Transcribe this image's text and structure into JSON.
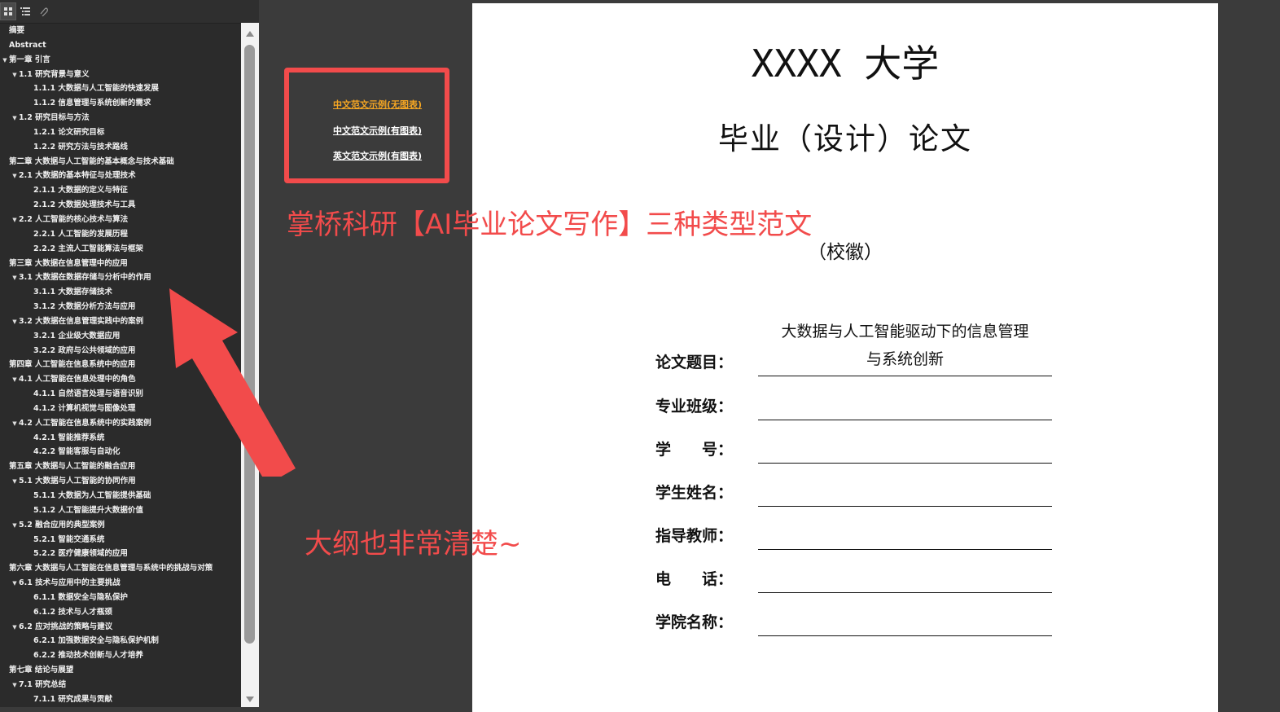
{
  "outline": [
    {
      "level": 0,
      "toggle": false,
      "label": "摘要"
    },
    {
      "level": 0,
      "toggle": false,
      "label": "Abstract"
    },
    {
      "level": 0,
      "toggle": true,
      "label": "第一章 引言"
    },
    {
      "level": 1,
      "toggle": true,
      "label": "1.1 研究背景与意义"
    },
    {
      "level": 2,
      "toggle": false,
      "label": "1.1.1 大数据与人工智能的快速发展"
    },
    {
      "level": 2,
      "toggle": false,
      "label": "1.1.2 信息管理与系统创新的需求"
    },
    {
      "level": 1,
      "toggle": true,
      "label": "1.2 研究目标与方法"
    },
    {
      "level": 2,
      "toggle": false,
      "label": "1.2.1 论文研究目标"
    },
    {
      "level": 2,
      "toggle": false,
      "label": "1.2.2 研究方法与技术路线"
    },
    {
      "level": 0,
      "toggle": false,
      "label": "第二章 大数据与人工智能的基本概念与技术基础"
    },
    {
      "level": 1,
      "toggle": true,
      "label": "2.1 大数据的基本特征与处理技术"
    },
    {
      "level": 2,
      "toggle": false,
      "label": "2.1.1 大数据的定义与特征"
    },
    {
      "level": 2,
      "toggle": false,
      "label": "2.1.2 大数据处理技术与工具"
    },
    {
      "level": 1,
      "toggle": true,
      "label": "2.2 人工智能的核心技术与算法"
    },
    {
      "level": 2,
      "toggle": false,
      "label": "2.2.1 人工智能的发展历程"
    },
    {
      "level": 2,
      "toggle": false,
      "label": "2.2.2 主流人工智能算法与框架"
    },
    {
      "level": 0,
      "toggle": false,
      "label": "第三章 大数据在信息管理中的应用"
    },
    {
      "level": 1,
      "toggle": true,
      "label": "3.1 大数据在数据存储与分析中的作用"
    },
    {
      "level": 2,
      "toggle": false,
      "label": "3.1.1 大数据存储技术"
    },
    {
      "level": 2,
      "toggle": false,
      "label": "3.1.2 大数据分析方法与应用"
    },
    {
      "level": 1,
      "toggle": true,
      "label": "3.2 大数据在信息管理实践中的案例"
    },
    {
      "level": 2,
      "toggle": false,
      "label": "3.2.1 企业级大数据应用"
    },
    {
      "level": 2,
      "toggle": false,
      "label": "3.2.2 政府与公共领域的应用"
    },
    {
      "level": 0,
      "toggle": false,
      "label": "第四章 人工智能在信息系统中的应用"
    },
    {
      "level": 1,
      "toggle": true,
      "label": "4.1 人工智能在信息处理中的角色"
    },
    {
      "level": 2,
      "toggle": false,
      "label": "4.1.1 自然语言处理与语音识别"
    },
    {
      "level": 2,
      "toggle": false,
      "label": "4.1.2 计算机视觉与图像处理"
    },
    {
      "level": 1,
      "toggle": true,
      "label": "4.2 人工智能在信息系统中的实践案例"
    },
    {
      "level": 2,
      "toggle": false,
      "label": "4.2.1 智能推荐系统"
    },
    {
      "level": 2,
      "toggle": false,
      "label": "4.2.2 智能客服与自动化"
    },
    {
      "level": 0,
      "toggle": false,
      "label": "第五章 大数据与人工智能的融合应用"
    },
    {
      "level": 1,
      "toggle": true,
      "label": "5.1 大数据与人工智能的协同作用"
    },
    {
      "level": 2,
      "toggle": false,
      "label": "5.1.1 大数据为人工智能提供基础"
    },
    {
      "level": 2,
      "toggle": false,
      "label": "5.1.2 人工智能提升大数据价值"
    },
    {
      "level": 1,
      "toggle": true,
      "label": "5.2 融合应用的典型案例"
    },
    {
      "level": 2,
      "toggle": false,
      "label": "5.2.1 智能交通系统"
    },
    {
      "level": 2,
      "toggle": false,
      "label": "5.2.2 医疗健康领域的应用"
    },
    {
      "level": 0,
      "toggle": false,
      "label": "第六章 大数据与人工智能在信息管理与系统中的挑战与对策"
    },
    {
      "level": 1,
      "toggle": true,
      "label": "6.1 技术与应用中的主要挑战"
    },
    {
      "level": 2,
      "toggle": false,
      "label": "6.1.1 数据安全与隐私保护"
    },
    {
      "level": 2,
      "toggle": false,
      "label": "6.1.2 技术与人才瓶颈"
    },
    {
      "level": 1,
      "toggle": true,
      "label": "6.2 应对挑战的策略与建议"
    },
    {
      "level": 2,
      "toggle": false,
      "label": "6.2.1 加强数据安全与隐私保护机制"
    },
    {
      "level": 2,
      "toggle": false,
      "label": "6.2.2 推动技术创新与人才培养"
    },
    {
      "level": 0,
      "toggle": false,
      "label": "第七章 结论与展望"
    },
    {
      "level": 1,
      "toggle": true,
      "label": "7.1 研究总结"
    },
    {
      "level": 2,
      "toggle": false,
      "label": "7.1.1 研究成果与贡献"
    }
  ],
  "sample_links": [
    {
      "label": "中文范文示例(无图表)",
      "active": true
    },
    {
      "label": "中文范文示例(有图表)",
      "active": false
    },
    {
      "label": "英文范文示例(有图表)",
      "active": false
    }
  ],
  "annotations": {
    "headline": "掌桥科研【AI毕业论文写作】三种类型范文",
    "outline_note": "大纲也非常清楚~"
  },
  "document": {
    "university": "XXXX 大学",
    "thesis_type": "毕业（设计）论文",
    "emblem": "（校徽）",
    "title_line1": "大数据与人工智能驱动下的信息管理",
    "title_line2": "与系统创新",
    "fields": [
      {
        "label": "论文题目："
      },
      {
        "label": "专业班级："
      },
      {
        "label": "学　　号："
      },
      {
        "label": "学生姓名："
      },
      {
        "label": "指导教师："
      },
      {
        "label": "电　　话："
      },
      {
        "label": "学院名称："
      }
    ]
  },
  "colors": {
    "annotation_red": "#f24b4b",
    "active_link": "#f5a623"
  },
  "icons": {
    "toolbar": [
      "thumbnails-icon",
      "outline-icon",
      "attachment-icon"
    ]
  }
}
